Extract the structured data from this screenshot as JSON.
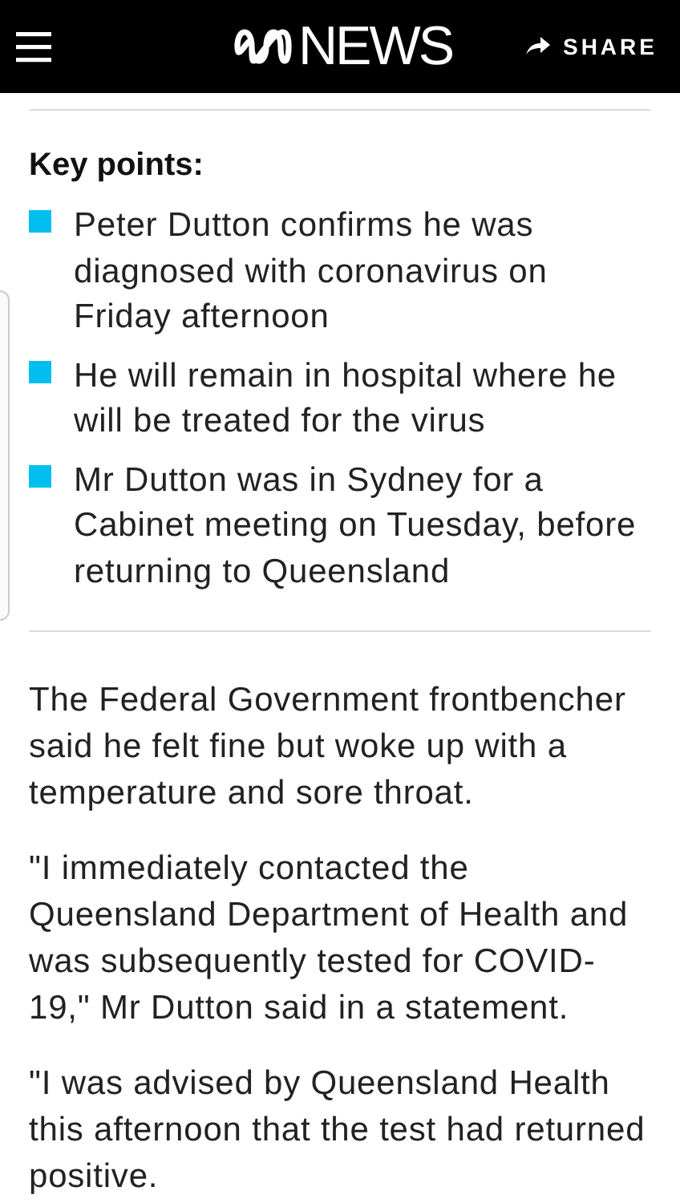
{
  "header": {
    "brand": "NEWS",
    "share": "SHARE"
  },
  "key_points": {
    "title": "Key points:",
    "items": [
      {
        "text": "Peter Dutton confirms he was diagnosed with coronavirus on Friday afternoon"
      },
      {
        "text": "He will remain in hospital where he will be treated for the virus"
      },
      {
        "text": "Mr Dutton was in Sydney for a Cabinet meeting on Tuesday, before returning to Queensland"
      }
    ]
  },
  "paragraphs": [
    "The Federal Government frontbencher said he felt fine but woke up with a temperature and sore throat.",
    "\"I immediately contacted the Queensland Department of Health and was subsequently tested for COVID-19,\" Mr Dutton said in a statement.",
    "\"I was advised by Queensland Health this afternoon that the test had returned positive."
  ]
}
